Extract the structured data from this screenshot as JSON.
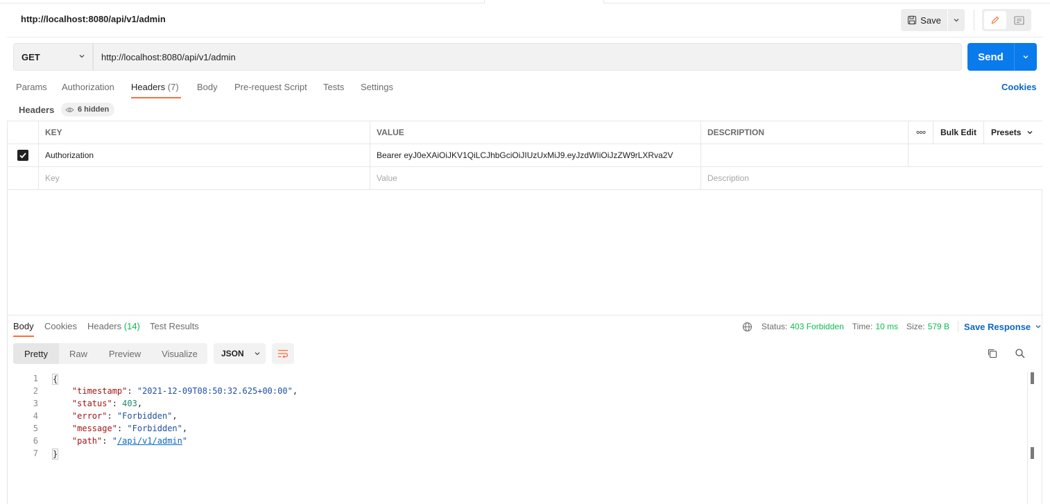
{
  "request": {
    "title": "http://localhost:8080/api/v1/admin",
    "save_label": "Save",
    "method": "GET",
    "url": "http://localhost:8080/api/v1/admin",
    "send_label": "Send",
    "tabs": [
      {
        "label": "Params",
        "count": ""
      },
      {
        "label": "Authorization",
        "count": ""
      },
      {
        "label": "Headers",
        "count": "(7)"
      },
      {
        "label": "Body",
        "count": ""
      },
      {
        "label": "Pre-request Script",
        "count": ""
      },
      {
        "label": "Tests",
        "count": ""
      },
      {
        "label": "Settings",
        "count": ""
      }
    ],
    "cookies_label": "Cookies"
  },
  "headers_section": {
    "label": "Headers",
    "hidden_label": "6 hidden",
    "columns": {
      "key": "KEY",
      "value": "VALUE",
      "description": "DESCRIPTION",
      "bulk_edit": "Bulk Edit",
      "presets": "Presets"
    },
    "rows": [
      {
        "checked": true,
        "key": "Authorization",
        "value": "Bearer eyJ0eXAiOiJKV1QiLCJhbGciOiJIUzUxMiJ9.eyJzdWIiOiJzZW9rLXRva2V",
        "description": ""
      }
    ],
    "placeholder": {
      "key": "Key",
      "value": "Value",
      "description": "Description"
    }
  },
  "response": {
    "tabs": [
      {
        "label": "Body",
        "count": ""
      },
      {
        "label": "Cookies",
        "count": ""
      },
      {
        "label": "Headers",
        "count": "(14)"
      },
      {
        "label": "Test Results",
        "count": ""
      }
    ],
    "status_label": "Status:",
    "status_value": "403 Forbidden",
    "time_label": "Time:",
    "time_value": "10 ms",
    "size_label": "Size:",
    "size_value": "579 B",
    "save_response_label": "Save Response",
    "view_tabs": [
      "Pretty",
      "Raw",
      "Preview",
      "Visualize"
    ],
    "format": "JSON",
    "lines": [
      "1",
      "2",
      "3",
      "4",
      "5",
      "6",
      "7"
    ],
    "body": {
      "open": "{",
      "close": "}",
      "fields": [
        {
          "key": "\"timestamp\"",
          "value": "\"2021-12-09T08:50:32.625+00:00\"",
          "kind": "string"
        },
        {
          "key": "\"status\"",
          "value": "403",
          "kind": "number"
        },
        {
          "key": "\"error\"",
          "value": "\"Forbidden\"",
          "kind": "string"
        },
        {
          "key": "\"message\"",
          "value": "\"Forbidden\"",
          "kind": "string"
        },
        {
          "key": "\"path\"",
          "value": "/api/v1/admin",
          "kind": "link"
        }
      ]
    }
  },
  "colors": {
    "accent": "#ff6c37",
    "send": "#097bed",
    "success": "#0cbb52",
    "link": "#0a67c4"
  }
}
